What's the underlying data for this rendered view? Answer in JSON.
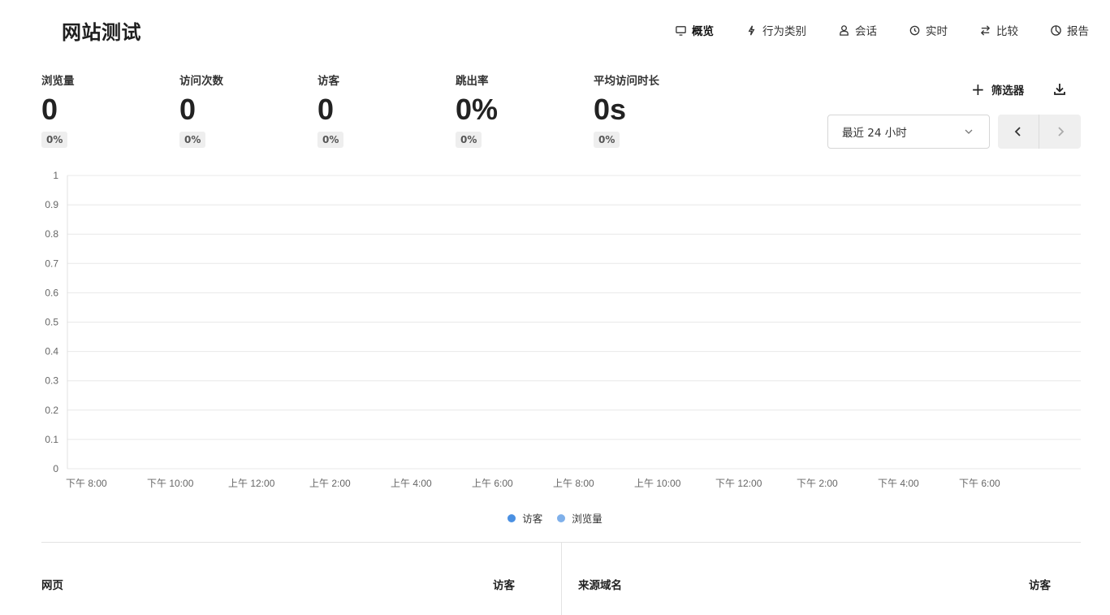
{
  "site": {
    "title": "网站测试"
  },
  "nav": [
    {
      "label": "概览",
      "icon": "monitor-icon",
      "active": true
    },
    {
      "label": "行为类别",
      "icon": "bolt-icon",
      "active": false
    },
    {
      "label": "会话",
      "icon": "user-icon",
      "active": false
    },
    {
      "label": "实时",
      "icon": "clock-icon",
      "active": false
    },
    {
      "label": "比较",
      "icon": "swap-icon",
      "active": false
    },
    {
      "label": "报告",
      "icon": "pie-icon",
      "active": false
    }
  ],
  "metrics": [
    {
      "label": "浏览量",
      "value": "0",
      "change": "0%"
    },
    {
      "label": "访问次数",
      "value": "0",
      "change": "0%"
    },
    {
      "label": "访客",
      "value": "0",
      "change": "0%"
    },
    {
      "label": "跳出率",
      "value": "0%",
      "change": "0%"
    },
    {
      "label": "平均访问时长",
      "value": "0s",
      "change": "0%"
    }
  ],
  "toolbar": {
    "filter_label": "筛选器",
    "date_range": "最近 24 小时"
  },
  "chart_data": {
    "type": "bar",
    "categories": [
      "下午 8:00",
      "下午 10:00",
      "上午 12:00",
      "上午 2:00",
      "上午 4:00",
      "上午 6:00",
      "上午 8:00",
      "上午 10:00",
      "下午 12:00",
      "下午 2:00",
      "下午 4:00",
      "下午 6:00"
    ],
    "series": [
      {
        "name": "访客",
        "values": [
          0,
          0,
          0,
          0,
          0,
          0,
          0,
          0,
          0,
          0,
          0,
          0
        ],
        "color": "#4a90e2"
      },
      {
        "name": "浏览量",
        "values": [
          0,
          0,
          0,
          0,
          0,
          0,
          0,
          0,
          0,
          0,
          0,
          0
        ],
        "color": "#7fb0ea"
      }
    ],
    "yticks": [
      "0",
      "0.1",
      "0.2",
      "0.3",
      "0.4",
      "0.5",
      "0.6",
      "0.7",
      "0.8",
      "0.9",
      "1"
    ],
    "ylim": [
      0,
      1
    ],
    "grid": true,
    "legend_position": "bottom-center"
  },
  "tables": {
    "pages": {
      "title": "网页",
      "metric": "访客"
    },
    "referrers": {
      "title": "来源域名",
      "metric": "访客"
    }
  }
}
